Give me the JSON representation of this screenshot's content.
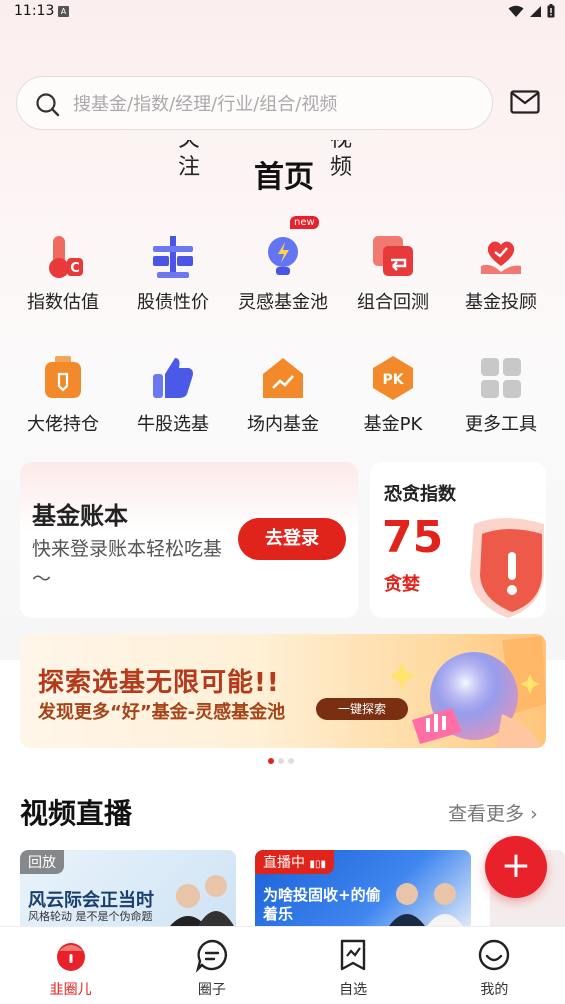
{
  "status_bar": {
    "time": "11:13",
    "notification_letter": "A"
  },
  "search": {
    "placeholder": "搜基金/指数/经理/行业/组合/视频"
  },
  "tabs": {
    "follow": [
      "关",
      "注"
    ],
    "home": "首页",
    "video": [
      "视",
      "频"
    ]
  },
  "tools": [
    {
      "label": "指数估值",
      "icon": "thermometer-icon",
      "color": "#e83a3a"
    },
    {
      "label": "股债性价",
      "icon": "balance-scale-icon",
      "color": "#4a55e6"
    },
    {
      "label": "灵感基金池",
      "icon": "lightbulb-icon",
      "color": "#5a6cf0",
      "badge": "new"
    },
    {
      "label": "组合回测",
      "icon": "backtest-icon",
      "color": "#e83a3a"
    },
    {
      "label": "基金投顾",
      "icon": "heart-hand-icon",
      "color": "#e83a3a"
    },
    {
      "label": "大佬持仓",
      "icon": "bag-icon",
      "color": "#f28a2c"
    },
    {
      "label": "牛股选基",
      "icon": "thumb-up-icon",
      "color": "#4a5ae6"
    },
    {
      "label": "场内基金",
      "icon": "house-chart-icon",
      "color": "#f28a2c"
    },
    {
      "label": "基金PK",
      "icon": "pk-icon",
      "color": "#f28a2c"
    },
    {
      "label": "更多工具",
      "icon": "grid-icon",
      "color": "#c8c8c8"
    }
  ],
  "account_card": {
    "title": "基金账本",
    "subtitle": "快来登录账本轻松吃基～",
    "login_label": "去登录"
  },
  "fear_index": {
    "title": "恐贪指数",
    "value": "75",
    "state": "贪婪"
  },
  "banner": {
    "title": "探索选基无限可能!!",
    "subtitle": "发现更多“好”基金-灵感基金池",
    "button": "一键探索"
  },
  "video_section": {
    "title": "视频直播",
    "more": "查看更多",
    "cards": [
      {
        "tag": "回放",
        "text": "风云际会正当时",
        "sub": "风格轮动 是不是个伪命题"
      },
      {
        "tag": "直播中",
        "text": "为啥投固收+的偷着乐"
      }
    ]
  },
  "fab": "+",
  "bottom_nav": [
    {
      "label": "韭圈儿",
      "icon": "home-leek-icon",
      "active": true
    },
    {
      "label": "圈子",
      "icon": "chat-bubble-icon",
      "active": false
    },
    {
      "label": "自选",
      "icon": "bookmark-chart-icon",
      "active": false
    },
    {
      "label": "我的",
      "icon": "smiley-icon",
      "active": false
    }
  ],
  "colors": {
    "accent": "#e0241c",
    "text": "#222222",
    "muted": "#777777"
  }
}
